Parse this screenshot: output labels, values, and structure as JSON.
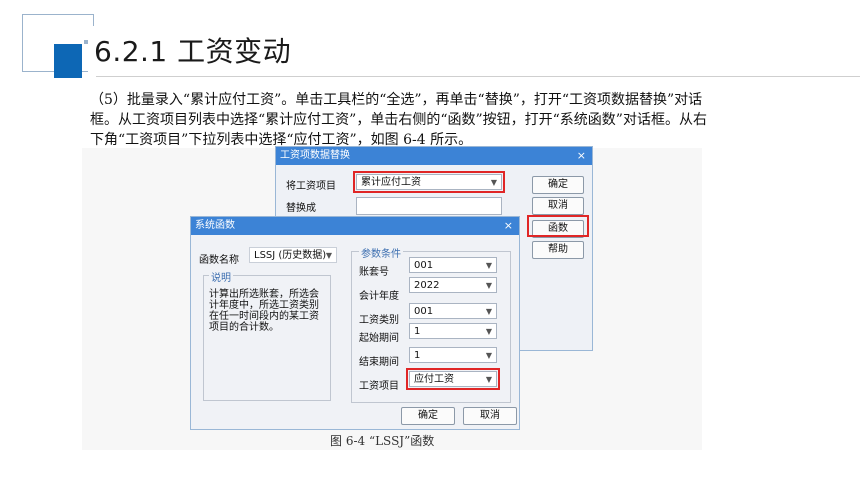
{
  "header": {
    "title": "6.2.1  工资变动"
  },
  "body_text": {
    "para1": "（5）批量录入“累计应付工资”。单击工具栏的“全选”，再单击“替换”，打开“工资项数据替换”对话框。从工资项目列表中选择“累计应付工资”，单击右侧的“函数”按钮，打开“系统函数”对话框。从右下角“工资项目”下拉列表中选择“应付工资”，如图 6-4 所示。"
  },
  "replace_dialog": {
    "title": "工资项数据替换",
    "close": "×",
    "item_label": "将工资项目",
    "item_value": "累计应付工资",
    "replace_label": "替换成",
    "buttons": {
      "ok": "确定",
      "cancel": "取消",
      "function": "函数",
      "help": "帮助"
    }
  },
  "function_dialog": {
    "title": "系统函数",
    "close": "×",
    "name_label": "函数名称",
    "name_value": "LSSJ (历史数据)",
    "desc_group": "说明",
    "description": "计算出所选账套，所选会计年度中，所选工资类别在任一时间段内的某工资项目的合计数。",
    "param_group": "参数条件",
    "params": [
      {
        "label": "账套号",
        "value": "001"
      },
      {
        "label": "会计年度",
        "value": "2022"
      },
      {
        "label": "工资类别",
        "value": "001"
      },
      {
        "label": "起始期间",
        "value": "1"
      },
      {
        "label": "结束期间",
        "value": "1"
      },
      {
        "label": "工资项目",
        "value": "应付工资"
      }
    ],
    "buttons": {
      "ok": "确定",
      "cancel": "取消"
    }
  },
  "caption": "图 6-4  “LSSJ”函数",
  "icons": {
    "dropdown": "chevron-down-icon",
    "close": "close-icon"
  },
  "colors": {
    "accent": "#0d67b5",
    "dialog_header": "#3c83d6",
    "highlight": "#e02626"
  }
}
